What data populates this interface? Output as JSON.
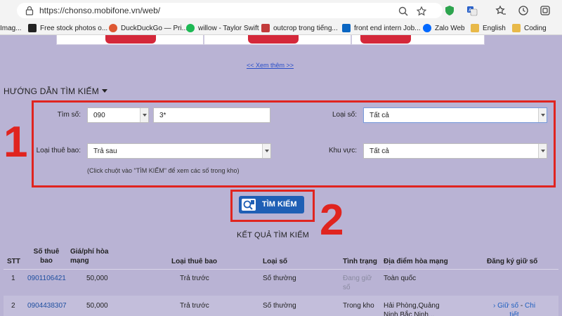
{
  "browser": {
    "url": "https://chonso.mobifone.vn/web/",
    "bookmarks": [
      {
        "label": "Imag...",
        "color": "#ffffff"
      },
      {
        "label": "Free stock photos o...",
        "color": "#222222"
      },
      {
        "label": "DuckDuckGo — Pri...",
        "color": "#de5833"
      },
      {
        "label": "willow - Taylor Swift",
        "color": "#1db954"
      },
      {
        "label": "outcrop trong tiếng...",
        "color": "#c23b3b"
      },
      {
        "label": "front end intern Job...",
        "color": "#0a66c2"
      },
      {
        "label": "Zalo Web",
        "color": "#0068ff"
      },
      {
        "label": "English",
        "color": "#e8b949"
      },
      {
        "label": "Coding",
        "color": "#e8b949"
      }
    ]
  },
  "page": {
    "see_more": "<< Xem thêm >>",
    "guide_title": "HƯỚNG DẪN TÌM KIẾM",
    "annotations": {
      "box1": "1",
      "box2": "2"
    },
    "form": {
      "tim_so_label": "Tìm số:",
      "prefix_value": "090",
      "number_value": "3*",
      "loai_so_label": "Loại số:",
      "loai_so_value": "Tất cả",
      "loai_thue_bao_label": "Loại thuê bao:",
      "loai_thue_bao_value": "Trả sau",
      "khu_vuc_label": "Khu vực:",
      "khu_vuc_value": "Tất cả",
      "hint": "(Click chuột vào \"TÌM KIẾM\" để xem các số trong kho)"
    },
    "search_button": "TÌM KIẾM",
    "result_title": "KẾT QUẢ TÌM KIẾM",
    "table": {
      "headers": {
        "stt": "STT",
        "so_thue_bao": "Số thuê bao",
        "gia_phi": "Giá/phí hòa mạng",
        "loai_thue_bao": "Loại thuê bao",
        "loai_so": "Loại số",
        "tinh_trang": "Tình trạng",
        "dia_diem": "Địa điểm hòa mạng",
        "dang_ky": "Đăng ký giữ số"
      },
      "rows": [
        {
          "stt": "1",
          "so": "0901106421",
          "gia": "50,000",
          "loai_tb": "Trả trước",
          "loai_so": "Số thường",
          "tinh_trang": "Đang giữ số",
          "dia_diem": "Toàn quốc",
          "action": ""
        },
        {
          "stt": "2",
          "so": "0904438307",
          "gia": "50,000",
          "loai_tb": "Trả trước",
          "loai_so": "Số thường",
          "tinh_trang": "Trong kho",
          "dia_diem": "Hải Phòng,Quảng Ninh,Bắc Ninh...",
          "action": "Giữ số",
          "action_sep": "-",
          "action2": "Chi tiết"
        }
      ]
    }
  },
  "colors": {
    "annotation": "#e0241f",
    "button": "#1f5fb5",
    "page_bg": "#b9b3d4"
  }
}
